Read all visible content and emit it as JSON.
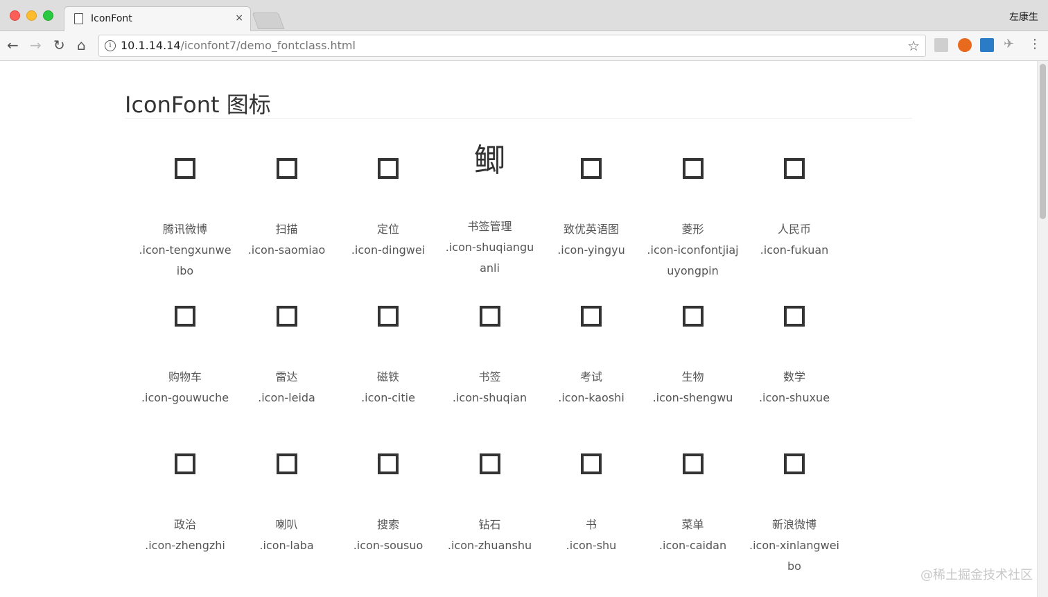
{
  "browser": {
    "tab_title": "IconFont",
    "tab_close": "×",
    "profile_name": "左康生",
    "url_host": "10.1.14.14",
    "url_path": "/iconfont7/demo_fontclass.html",
    "nav": {
      "back": "←",
      "forward": "→",
      "reload": "↻",
      "home": "⌂",
      "info": "i",
      "star": "☆",
      "menu": "⋮",
      "ext4": "✈"
    }
  },
  "page": {
    "title": "IconFont 图标",
    "icons": [
      {
        "glyph_type": "box",
        "glyph": "",
        "name": "腾讯微博",
        "code": ".icon-tengxunweibo"
      },
      {
        "glyph_type": "box",
        "glyph": "",
        "name": "扫描",
        "code": ".icon-saomiao"
      },
      {
        "glyph_type": "box",
        "glyph": "",
        "name": "定位",
        "code": ".icon-dingwei"
      },
      {
        "glyph_type": "char",
        "glyph": "鲫",
        "name": "书签管理",
        "code": ".icon-shuqianguanli"
      },
      {
        "glyph_type": "box",
        "glyph": "",
        "name": "致优英语图",
        "code": ".icon-yingyu"
      },
      {
        "glyph_type": "box",
        "glyph": "",
        "name": "菱形",
        "code": ".icon-iconfontjiajuyongpin"
      },
      {
        "glyph_type": "box",
        "glyph": "",
        "name": "人民币",
        "code": ".icon-fukuan"
      },
      {
        "glyph_type": "box",
        "glyph": "",
        "name": "购物车",
        "code": ".icon-gouwuche"
      },
      {
        "glyph_type": "box",
        "glyph": "",
        "name": "雷达",
        "code": ".icon-leida"
      },
      {
        "glyph_type": "box",
        "glyph": "",
        "name": "磁铁",
        "code": ".icon-citie"
      },
      {
        "glyph_type": "box",
        "glyph": "",
        "name": "书签",
        "code": ".icon-shuqian"
      },
      {
        "glyph_type": "box",
        "glyph": "",
        "name": "考试",
        "code": ".icon-kaoshi"
      },
      {
        "glyph_type": "box",
        "glyph": "",
        "name": "生物",
        "code": ".icon-shengwu"
      },
      {
        "glyph_type": "box",
        "glyph": "",
        "name": "数学",
        "code": ".icon-shuxue"
      },
      {
        "glyph_type": "box",
        "glyph": "",
        "name": "政治",
        "code": ".icon-zhengzhi"
      },
      {
        "glyph_type": "box",
        "glyph": "",
        "name": "喇叭",
        "code": ".icon-laba"
      },
      {
        "glyph_type": "box",
        "glyph": "",
        "name": "搜索",
        "code": ".icon-sousuo"
      },
      {
        "glyph_type": "box",
        "glyph": "",
        "name": "钻石",
        "code": ".icon-zhuanshu"
      },
      {
        "glyph_type": "box",
        "glyph": "",
        "name": "书",
        "code": ".icon-shu"
      },
      {
        "glyph_type": "box",
        "glyph": "",
        "name": "菜单",
        "code": ".icon-caidan"
      },
      {
        "glyph_type": "box",
        "glyph": "",
        "name": "新浪微博",
        "code": ".icon-xinlangweibo"
      }
    ]
  },
  "watermark": "@稀土掘金技术社区"
}
